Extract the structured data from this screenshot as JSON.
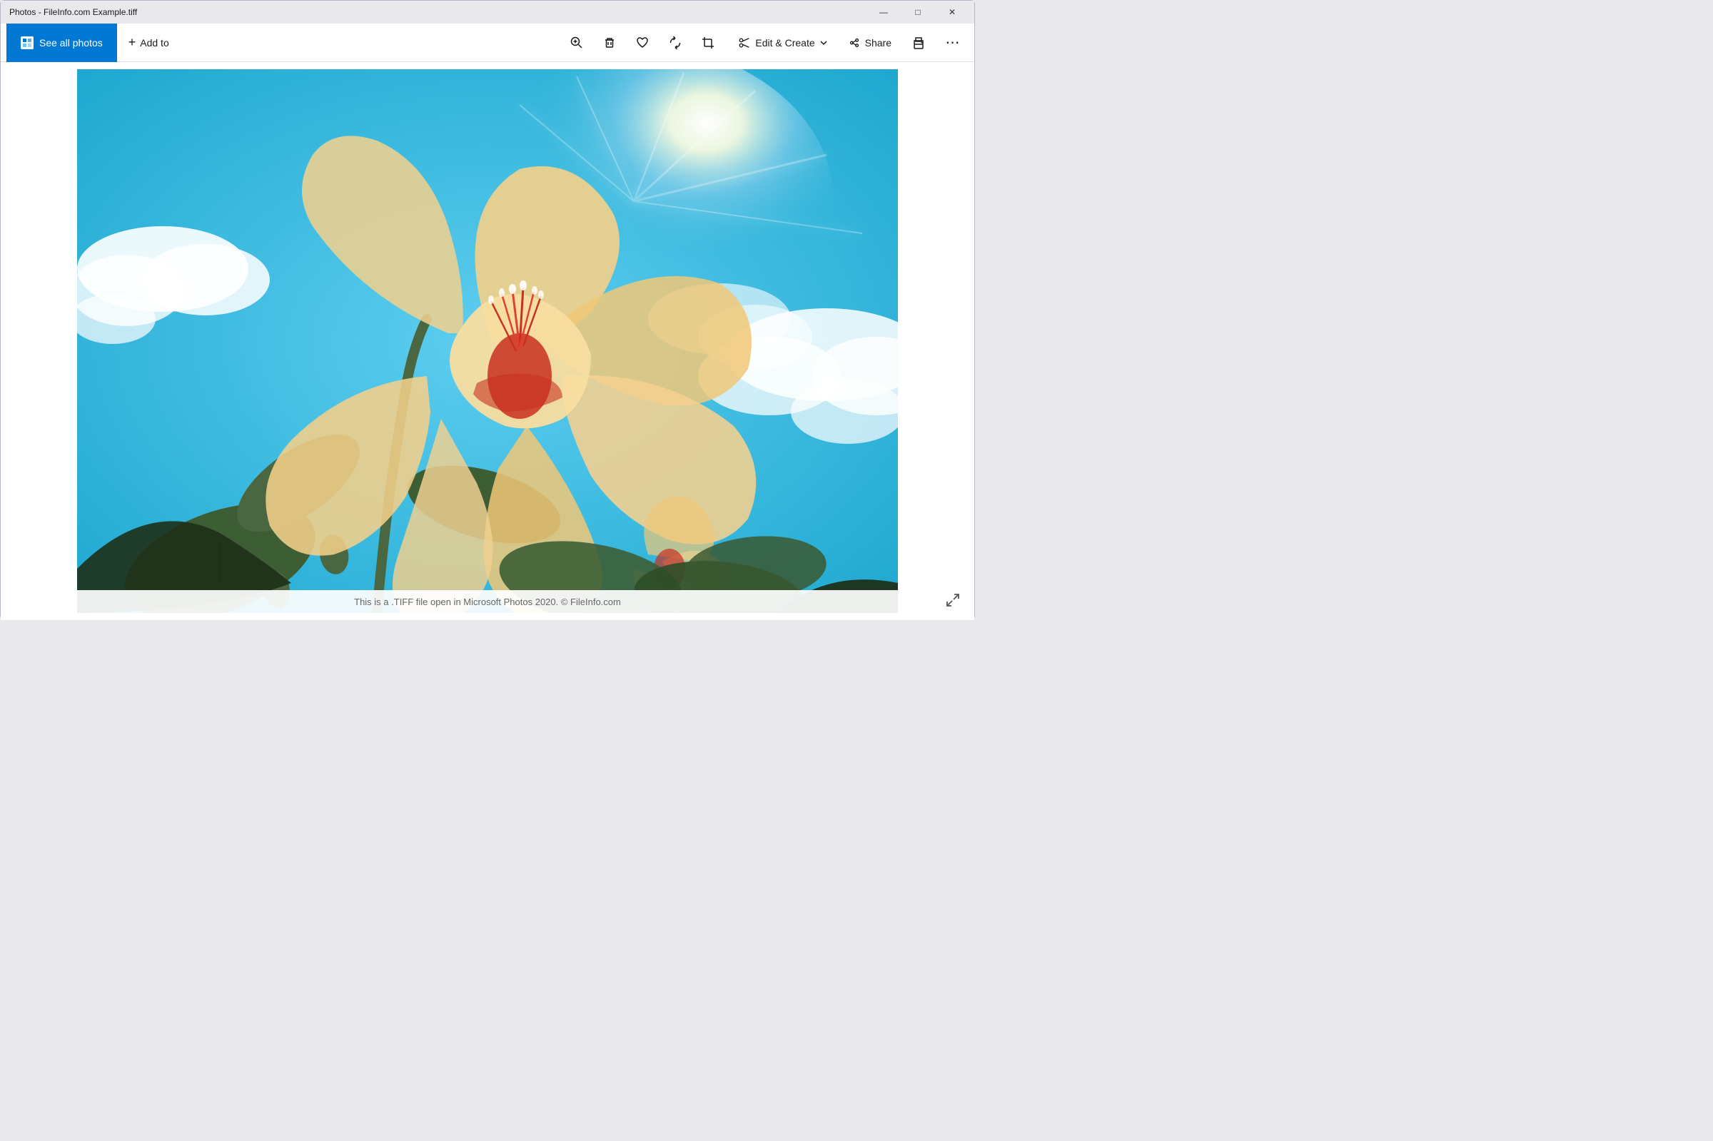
{
  "window": {
    "title": "Photos - FileInfo.com Example.tiff"
  },
  "titlebar": {
    "title": "Photos - FileInfo.com Example.tiff",
    "minimize_label": "–",
    "maximize_label": "□",
    "close_label": "✕"
  },
  "toolbar": {
    "see_all_photos_label": "See all photos",
    "add_to_label": "Add to",
    "zoom_icon": "zoom",
    "delete_icon": "delete",
    "favorite_icon": "heart",
    "rotate_icon": "rotate",
    "crop_icon": "crop",
    "edit_create_label": "Edit & Create",
    "share_label": "Share",
    "print_icon": "print",
    "more_icon": "more"
  },
  "photo": {
    "caption": "This is a .TIFF file open in Microsoft Photos 2020. © FileInfo.com"
  }
}
